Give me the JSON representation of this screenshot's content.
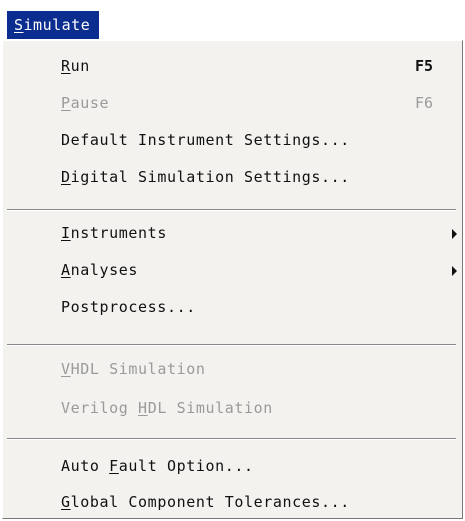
{
  "menubar": {
    "title_mnemonic": "S",
    "title_rest": "imulate"
  },
  "menu": {
    "run": {
      "pre": "",
      "mnemonic": "R",
      "post": "un",
      "shortcut": "F5",
      "enabled": true
    },
    "pause": {
      "pre": "",
      "mnemonic": "P",
      "post": "ause",
      "shortcut": "F6",
      "enabled": false
    },
    "default_instrument_settings": {
      "label": "Default Instrument Settings...",
      "enabled": true
    },
    "digital_simulation_settings": {
      "pre": "",
      "mnemonic": "D",
      "post": "igital Simulation Settings...",
      "enabled": true
    },
    "instruments": {
      "pre": "",
      "mnemonic": "I",
      "post": "nstruments",
      "has_submenu": true,
      "enabled": true
    },
    "analyses": {
      "pre": "",
      "mnemonic": "A",
      "post": "nalyses",
      "has_submenu": true,
      "enabled": true
    },
    "postprocess": {
      "label": "Postprocess...",
      "enabled": true
    },
    "vhdl_simulation": {
      "pre": "",
      "mnemonic": "V",
      "post": "HDL Simulation",
      "enabled": false
    },
    "verilog_hdl_simulation": {
      "pre": "Verilog ",
      "mnemonic": "H",
      "post": "DL Simulation",
      "enabled": false
    },
    "auto_fault_option": {
      "pre": "Auto ",
      "mnemonic": "F",
      "post": "ault Option...",
      "enabled": true
    },
    "global_component_tolerances": {
      "pre": "",
      "mnemonic": "G",
      "post": "lobal Component Tolerances...",
      "enabled": true
    }
  },
  "colors": {
    "menubar_highlight": "#0b2d8f",
    "menu_background": "#f3f2ee",
    "disabled_text": "#9a9a9a"
  }
}
